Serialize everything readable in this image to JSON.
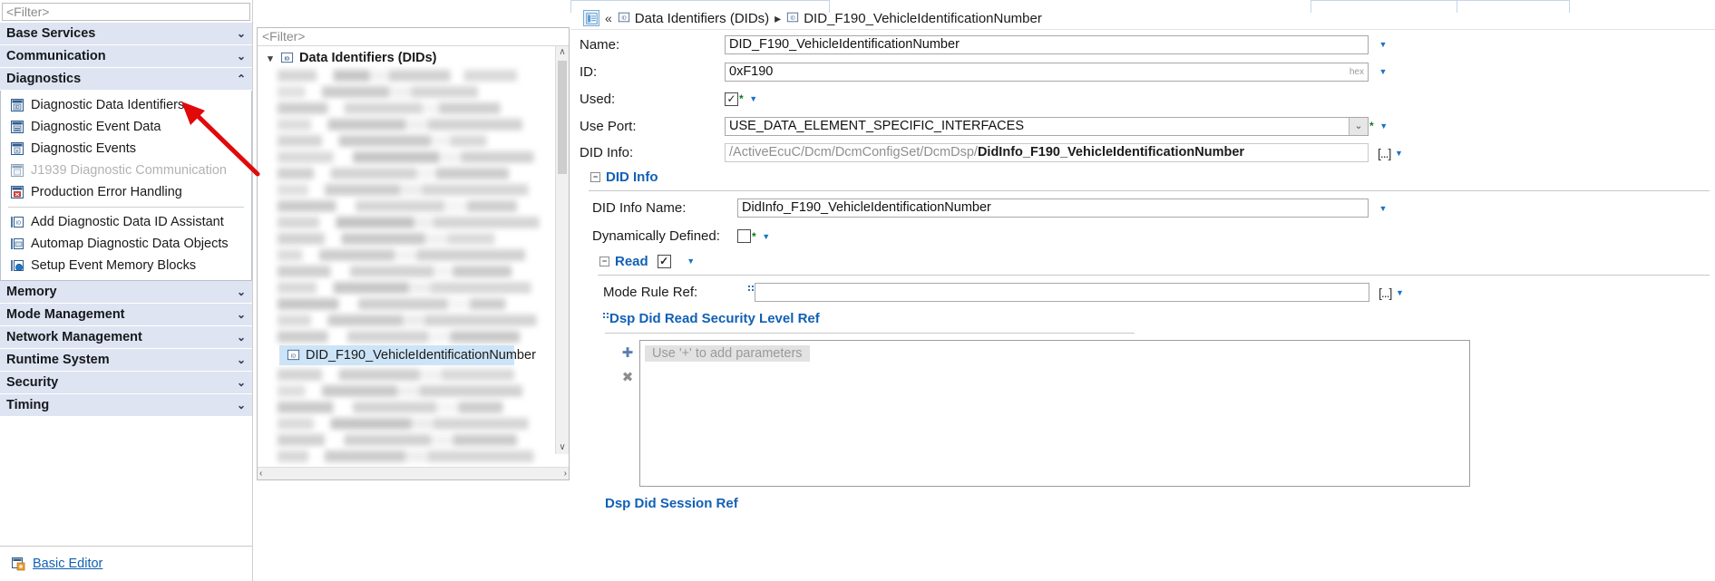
{
  "left_nav": {
    "filter_placeholder": "<Filter>",
    "groups": [
      {
        "label": "Base Services",
        "state": "collapsed",
        "chevron": "chevron-double-down"
      },
      {
        "label": "Communication",
        "state": "collapsed",
        "chevron": "chevron-double-down"
      },
      {
        "label": "Diagnostics",
        "state": "expanded",
        "chevron": "chevron-double-up"
      }
    ],
    "diagnostics_items": [
      {
        "label": "Diagnostic Data Identifiers",
        "icon": "did-list-icon",
        "disabled": false
      },
      {
        "label": "Diagnostic Event Data",
        "icon": "event-data-icon",
        "disabled": false
      },
      {
        "label": "Diagnostic Events",
        "icon": "events-icon",
        "disabled": false
      },
      {
        "label": "J1939 Diagnostic Communication",
        "icon": "j1939-icon",
        "disabled": true
      },
      {
        "label": "Production Error Handling",
        "icon": "production-error-icon",
        "disabled": false
      }
    ],
    "diagnostics_actions": [
      {
        "label": "Add Diagnostic Data ID Assistant",
        "icon": "add-did-assistant-icon"
      },
      {
        "label": "Automap Diagnostic Data Objects",
        "icon": "automap-icon"
      },
      {
        "label": "Setup Event Memory Blocks",
        "icon": "event-memory-icon"
      }
    ],
    "groups_after": [
      {
        "label": "Memory",
        "chevron": "chevron-double-down"
      },
      {
        "label": "Mode Management",
        "chevron": "chevron-double-down"
      },
      {
        "label": "Network Management",
        "chevron": "chevron-double-down"
      },
      {
        "label": "Runtime System",
        "chevron": "chevron-double-down"
      },
      {
        "label": "Security",
        "chevron": "chevron-double-down"
      },
      {
        "label": "Timing",
        "chevron": "chevron-double-down"
      }
    ],
    "basic_editor_label": "Basic Editor"
  },
  "tree_panel": {
    "filter_placeholder": "<Filter>",
    "root_label": "Data Identifiers (DIDs)",
    "selected_label": "DID_F190_VehicleIdentificationNumber",
    "scroll_up_glyph": "∧",
    "scroll_down_glyph": "∨",
    "scroll_left_glyph": "‹",
    "scroll_right_glyph": "›"
  },
  "breadcrumb": {
    "home_icon": "editor-home-icon",
    "back_glyph": "«",
    "separator_glyph": "▸",
    "items": [
      {
        "label": "Data Identifiers (DIDs)",
        "icon": "did-icon"
      },
      {
        "label": "DID_F190_VehicleIdentificationNumber",
        "icon": "did-icon"
      }
    ]
  },
  "form": {
    "name": {
      "label": "Name:",
      "value": "DID_F190_VehicleIdentificationNumber"
    },
    "id": {
      "label": "ID:",
      "value": "0xF190",
      "suffix": "hex"
    },
    "used": {
      "label": "Used:",
      "checked": true,
      "check_glyph": "✓",
      "star": "*"
    },
    "use_port": {
      "label": "Use Port:",
      "value": "USE_DATA_ELEMENT_SPECIFIC_INTERFACES",
      "star": "*",
      "dropdown_glyph": "⌄"
    },
    "did_info_ref": {
      "label": "DID Info:",
      "value_prefix": "/ActiveEcuC/Dcm/DcmConfigSet/DcmDsp/",
      "value_bold": "DidInfo_F190_VehicleIdentificationNumber",
      "browse_label": "[...]"
    },
    "did_info_section": {
      "label": "DID Info",
      "expander": "−"
    },
    "did_info_name": {
      "label": "DID Info Name:",
      "value": "DidInfo_F190_VehicleIdentificationNumber"
    },
    "dynamically_defined": {
      "label": "Dynamically Defined:",
      "checked": false,
      "star": "*"
    },
    "read_section": {
      "label": "Read",
      "expander": "−",
      "checked": true,
      "check_glyph": "✓"
    },
    "mode_rule_ref": {
      "label": "Mode Rule Ref:",
      "value": "",
      "browse_label": "[...]"
    },
    "security_level_ref_link": "Dsp Did Read Security Level Ref",
    "params": {
      "placeholder": "Use '+' to add parameters",
      "add_glyph": "✚",
      "remove_glyph": "✖"
    },
    "session_ref_link": "Dsp Did Session Ref"
  },
  "colors": {
    "accent_blue": "#1160b5",
    "group_header_bg": "#dfe4f2",
    "selection_bg": "#cce4f7",
    "annotation_red": "#e1090a"
  }
}
